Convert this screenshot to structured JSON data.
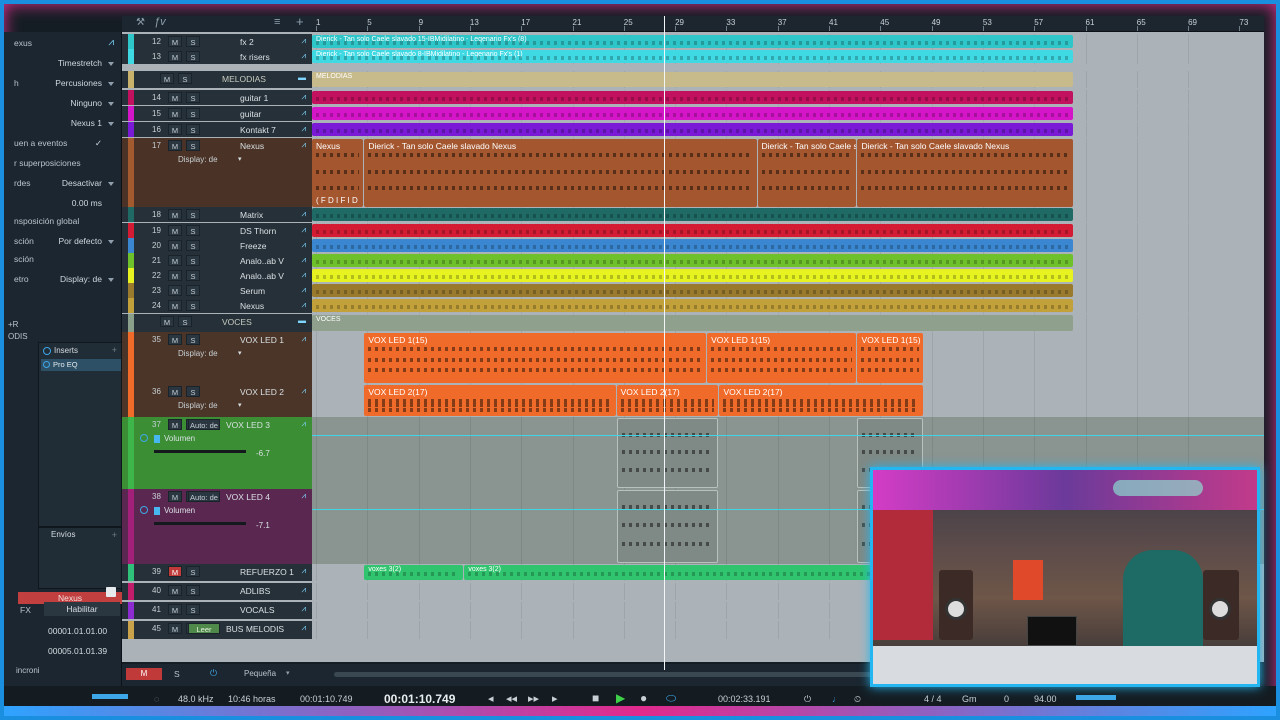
{
  "left_panel": {
    "top_label": "exus",
    "rows": [
      {
        "label": "",
        "value": "Timestretch"
      },
      {
        "label": "h",
        "value": "Percusiones"
      },
      {
        "label": "",
        "value": "Ninguno"
      },
      {
        "label": "",
        "value": "Nexus 1"
      },
      {
        "label": "uen a eventos",
        "value": "✓"
      },
      {
        "label": "r superposiciones",
        "value": ""
      },
      {
        "label": "rdes",
        "value": "Desactivar"
      },
      {
        "label": "",
        "value": "0.00 ms"
      },
      {
        "label": "nsposición global",
        "value": ""
      },
      {
        "label": "sción",
        "value": "Por defecto"
      },
      {
        "label": "sción",
        "value": ""
      },
      {
        "label": "etro",
        "value": "Display: de"
      }
    ],
    "inserts_label": "Inserts",
    "insert_plugin": "Pro EQ",
    "envios_label": "Envíos",
    "channel_name": "Nexus",
    "fx_label": "FX",
    "habilitar_label": "Habilitar",
    "time_a": "00001.01.01.00",
    "time_b": "00005.01.01.39",
    "sync_label": "incroni",
    "side_r": "+R",
    "side_odis": "ODIS"
  },
  "ruler": {
    "ticks": [
      "1",
      "5",
      "9",
      "13",
      "17",
      "21",
      "25",
      "29",
      "33",
      "37",
      "41",
      "45",
      "49",
      "53",
      "57",
      "61",
      "65",
      "69",
      "73"
    ]
  },
  "tracks": [
    {
      "num": "12",
      "name": "fx 2",
      "color": "#2ec6c8",
      "clip_color": "#2ec6c8",
      "clips": [
        {
          "label": "Dierick - Tan solo Caele slavado 15-IBMidilatino - Leqenario Fx's (8)"
        }
      ]
    },
    {
      "num": "13",
      "name": "fx risers",
      "color": "#3fd9e3",
      "clip_color": "#3fd9e3",
      "clips": [
        {
          "label": "Dierick - Tan solo Caele slavado 8-IBMidilatino - Leqenario Fx's (1)"
        }
      ]
    },
    {
      "num": "",
      "name": "MELODIAS",
      "color": "#c8b16a",
      "clip_color": "#c7bb8c",
      "clips": [
        {
          "label": "MELODIAS"
        }
      ]
    },
    {
      "num": "14",
      "name": "guitar 1",
      "color": "#c2115e",
      "clip_color": "#c2115e",
      "clips": [
        {
          "label": ""
        }
      ]
    },
    {
      "num": "15",
      "name": "guitar",
      "color": "#d516c8",
      "clip_color": "#d516c8",
      "clips": [
        {
          "label": ""
        }
      ]
    },
    {
      "num": "16",
      "name": "Kontakt 7",
      "color": "#7a1ad6",
      "clip_color": "#7a1ad6",
      "clips": [
        {
          "label": ""
        }
      ]
    },
    {
      "num": "17",
      "name": "Nexus",
      "color": "#a35a2f",
      "clip_color": "#a4562f",
      "display": "Display: de",
      "clips": [
        {
          "label": "Nexus"
        },
        {
          "label": "Dierick - Tan solo Caele slavado Nexus"
        },
        {
          "label": "Dierick - Tan solo Caele s"
        },
        {
          "label": "Dierick - Tan solo Caele slavado Nexus"
        }
      ],
      "clip_extra": "( F D I F I D"
    },
    {
      "num": "18",
      "name": "Matrix",
      "color": "#1f6a64",
      "clip_color": "#1f6a64",
      "clips": [
        {
          "label": ""
        }
      ]
    },
    {
      "num": "19",
      "name": "DS Thorn",
      "color": "#d31b33",
      "clip_color": "#d31b33",
      "clips": [
        {
          "label": ""
        }
      ]
    },
    {
      "num": "20",
      "name": "Freeze",
      "color": "#3a86d0",
      "clip_color": "#3a86d0",
      "clips": [
        {
          "label": ""
        }
      ]
    },
    {
      "num": "21",
      "name": "Analo..ab V",
      "color": "#6fc12c",
      "clip_color": "#6fc12c",
      "clips": [
        {
          "label": ""
        }
      ]
    },
    {
      "num": "22",
      "name": "Analo..ab V",
      "color": "#e6f321",
      "clip_color": "#e6f321",
      "clips": [
        {
          "label": ""
        }
      ]
    },
    {
      "num": "23",
      "name": "Serum",
      "color": "#9a7a2c",
      "clip_color": "#9a7a2c",
      "clips": [
        {
          "label": ""
        }
      ]
    },
    {
      "num": "24",
      "name": "Nexus",
      "color": "#c2a03a",
      "clip_color": "#c2a03a",
      "clips": [
        {
          "label": ""
        }
      ]
    },
    {
      "num": "",
      "name": "VOCES",
      "color": "#8aa08a",
      "clip_color": "#8fa08c",
      "clips": [
        {
          "label": "VOCES"
        }
      ]
    },
    {
      "num": "35",
      "name": "VOX LED 1",
      "color": "#f06b2a",
      "clip_color": "#f06b2a",
      "display": "Display: de",
      "clips": [
        {
          "label": "VOX LED 1(15)"
        },
        {
          "label": "VOX LED 1(15)"
        },
        {
          "label": "VOX LED 1(15)"
        }
      ]
    },
    {
      "num": "36",
      "name": "VOX LED 2",
      "color": "#f06b2a",
      "clip_color": "#f06b2a",
      "display": "Display: de",
      "clips": [
        {
          "label": "VOX LED 2(17)"
        },
        {
          "label": "VOX LED 2(17)"
        },
        {
          "label": "VOX LED 2(17)"
        }
      ]
    },
    {
      "num": "37",
      "name": "VOX LED 3",
      "color": "#3fb64a",
      "clip_color": "#8e9a96",
      "auto": "Auto: de",
      "param": "Volumen",
      "value": "-6.7",
      "clips": [
        {
          "label": ""
        },
        {
          "label": ""
        }
      ]
    },
    {
      "num": "38",
      "name": "VOX LED 4",
      "color": "#a21f7a",
      "clip_color": "#8e9a96",
      "auto": "Auto: de",
      "param": "Volumen",
      "value": "-7.1",
      "clips": [
        {
          "label": ""
        },
        {
          "label": ""
        }
      ]
    },
    {
      "num": "39",
      "name": "REFUERZO 1",
      "color": "#2fc07a",
      "clip_color": "#31c46e",
      "clips": [
        {
          "label": "voxes 3(2)"
        },
        {
          "label": "voxes 3(2)"
        }
      ]
    },
    {
      "num": "40",
      "name": "ADLIBS",
      "color": "#c21d6a",
      "clip_color": "#c21d6a",
      "clips": []
    },
    {
      "num": "41",
      "name": "VOCALS",
      "color": "#8b2bd0",
      "clip_color": "#8b2bd0",
      "clips": []
    },
    {
      "num": "45",
      "name": "BUS MELODIS",
      "color": "#c9a24a",
      "clip_color": "#c9a24a",
      "auto": "Leer",
      "clips": []
    }
  ],
  "bottom_bar": {
    "m": "M",
    "s": "S",
    "size_label": "Pequeña"
  },
  "transport": {
    "sample_rate": "48.0 kHz",
    "record_time": "10:46 horas",
    "position_small": "00:01:10.749",
    "position_big": "00:01:10.749",
    "end_time": "00:02:33.191",
    "signature": "4 / 4",
    "key": "Gm",
    "offset": "0",
    "tempo": "94.00"
  },
  "colors": {
    "accent": "#23b6f0",
    "frame_pink": "#e0308f"
  }
}
